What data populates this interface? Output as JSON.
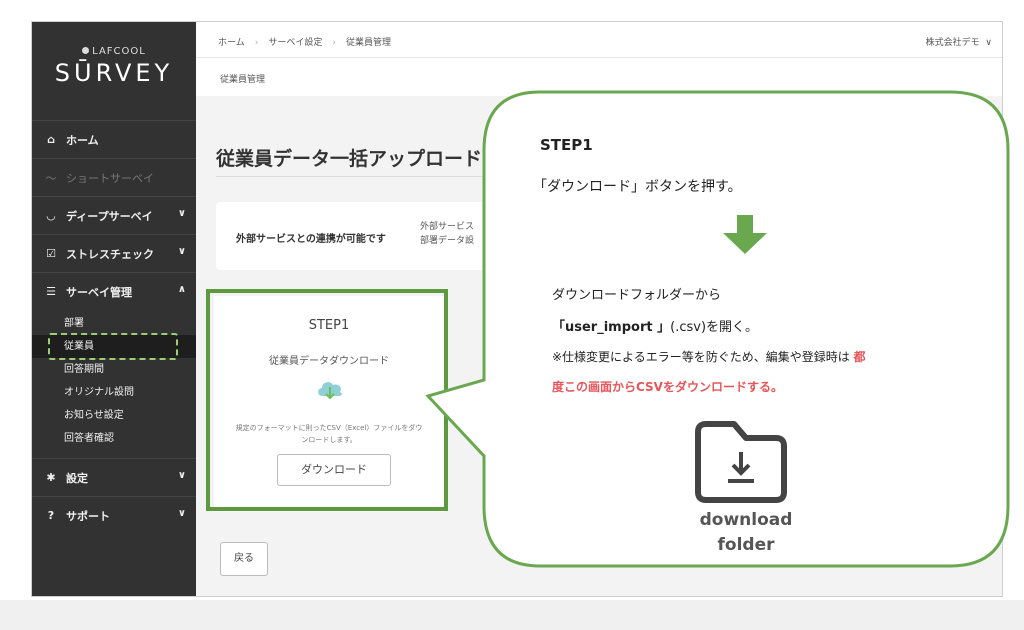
{
  "sidebar": {
    "logo_small": "LAFCOOL",
    "logo_big": "SŪRVEY",
    "items": [
      {
        "label": "ホーム",
        "icon": "home-icon"
      },
      {
        "label": "ショートサーベイ",
        "icon": "short-survey-icon"
      },
      {
        "label": "ディープサーベイ",
        "icon": "deep-survey-icon"
      },
      {
        "label": "ストレスチェック",
        "icon": "checkbox-icon"
      },
      {
        "label": "サーベイ管理",
        "icon": "sliders-icon"
      },
      {
        "label": "設定",
        "icon": "gear-icon"
      },
      {
        "label": "サポート",
        "icon": "question-icon"
      }
    ],
    "sub_items": [
      "部署",
      "従業員",
      "回答期間",
      "オリジナル設問",
      "お知らせ設定",
      "回答者確認"
    ]
  },
  "header": {
    "breadcrumbs": [
      "ホーム",
      "サーベイ設定",
      "従業員管理"
    ],
    "company": "株式会社デモ",
    "subtitle": "従業員管理"
  },
  "main": {
    "page_title": "従業員データ一括アップロード",
    "info_label": "外部サービスとの連携が可能です",
    "info_line1": "外部サービス",
    "info_line2": "部署データ設",
    "step_title": "STEP1",
    "step_subtitle": "従業員データダウンロード",
    "step_desc1": "規定のフォーマットに則ったCSV（Excel）ファイルをダウ",
    "step_desc2": "ンロードします。",
    "download_label": "ダウンロード",
    "back_label": "戻る"
  },
  "callout": {
    "step": "STEP1",
    "line1": "「ダウンロード」ボタンを押す。",
    "line2": "ダウンロードフォルダーから",
    "line3_bold": "「user_import 」",
    "line3_rest": "(.csv)を開く。",
    "line4_normal": "※仕様変更によるエラー等を防ぐため、編集や登録時は",
    "line4_red": "都",
    "line5": "度この画面からCSVをダウンロードする。",
    "folder_label_1": "download",
    "folder_label_2": "folder"
  },
  "colors": {
    "sidebar_bg": "#323232",
    "accent_green": "#5d9a3e",
    "callout_border": "#6aa84f",
    "highlight_red": "#e8555a"
  }
}
